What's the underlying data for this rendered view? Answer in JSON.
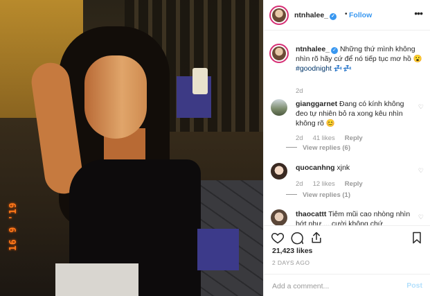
{
  "post": {
    "date_stamp": "16 9 '19",
    "username": "ntnhalee_",
    "follow_label": "Follow",
    "separator": "•",
    "more_label": "•••",
    "caption_text": "Những thứ mình không nhìn rõ hãy cứ để nó tiếp tục mơ hồ 😮",
    "hashtag": "#goodnight",
    "sleep_emoji": "💤💤",
    "caption_time": "2d"
  },
  "comments": [
    {
      "username": "gianggarnet",
      "text": "Đang có kính không đeo tự nhiên bỏ ra xong kêu nhìn không rõ 😊",
      "time": "2d",
      "likes": "41 likes",
      "reply_label": "Reply",
      "view_replies": "View replies (6)"
    },
    {
      "username": "quocanhng",
      "text": "xjnk",
      "time": "2d",
      "likes": "12 likes",
      "reply_label": "Reply",
      "view_replies": "View replies (1)"
    },
    {
      "username": "thaocattt",
      "text": "Tiêm mũi cao nhòng nhìn bớt như ... cười không chứ"
    }
  ],
  "actions": {
    "likes_count": "21,423 likes",
    "posted_ago": "2 DAYS AGO",
    "comment_placeholder": "Add a comment...",
    "post_label": "Post"
  },
  "colors": {
    "accent_blue": "#3897f0",
    "post_disabled": "#b2dffc",
    "story_ring": "#d62f74",
    "date_stamp_orange": "#ff7a1a"
  },
  "icons": [
    "heart-icon",
    "comment-icon",
    "share-icon",
    "bookmark-icon",
    "more-icon",
    "verified-badge-icon"
  ]
}
